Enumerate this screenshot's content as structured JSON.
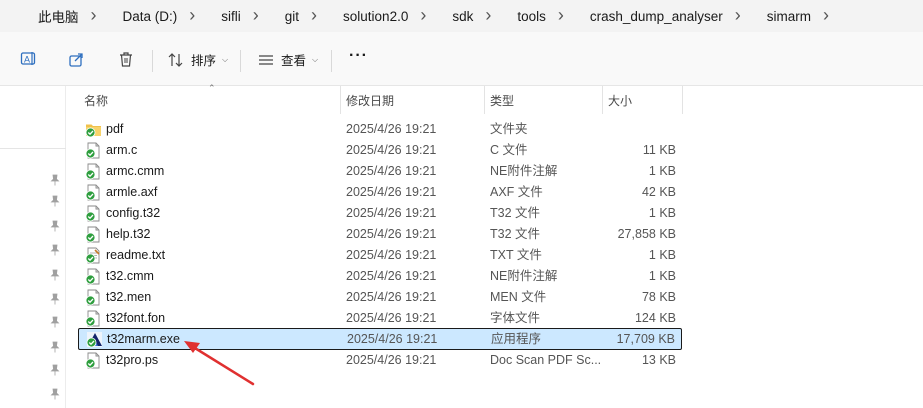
{
  "breadcrumb": [
    "此电脑",
    "Data (D:)",
    "sifli",
    "git",
    "solution2.0",
    "sdk",
    "tools",
    "crash_dump_analyser",
    "simarm"
  ],
  "toolbar": {
    "sort_label": "排序",
    "view_label": "查看",
    "more_label": "···"
  },
  "columns": {
    "name": "名称",
    "date": "修改日期",
    "type": "类型",
    "size": "大小"
  },
  "files": [
    {
      "name": "pdf",
      "date": "2025/4/26 19:21",
      "type": "文件夹",
      "size": "",
      "icon": "folder-icon"
    },
    {
      "name": "arm.c",
      "date": "2025/4/26 19:21",
      "type": "C 文件",
      "size": "11 KB",
      "icon": "file-icon"
    },
    {
      "name": "armc.cmm",
      "date": "2025/4/26 19:21",
      "type": "NE附件注解",
      "size": "1 KB",
      "icon": "file-icon"
    },
    {
      "name": "armle.axf",
      "date": "2025/4/26 19:21",
      "type": "AXF 文件",
      "size": "42 KB",
      "icon": "file-icon"
    },
    {
      "name": "config.t32",
      "date": "2025/4/26 19:21",
      "type": "T32 文件",
      "size": "1 KB",
      "icon": "file-icon"
    },
    {
      "name": "help.t32",
      "date": "2025/4/26 19:21",
      "type": "T32 文件",
      "size": "27,858 KB",
      "icon": "file-icon"
    },
    {
      "name": "readme.txt",
      "date": "2025/4/26 19:21",
      "type": "TXT 文件",
      "size": "1 KB",
      "icon": "text-file-icon"
    },
    {
      "name": "t32.cmm",
      "date": "2025/4/26 19:21",
      "type": "NE附件注解",
      "size": "1 KB",
      "icon": "file-icon"
    },
    {
      "name": "t32.men",
      "date": "2025/4/26 19:21",
      "type": "MEN 文件",
      "size": "78 KB",
      "icon": "file-icon"
    },
    {
      "name": "t32font.fon",
      "date": "2025/4/26 19:21",
      "type": "字体文件",
      "size": "124 KB",
      "icon": "file-icon"
    },
    {
      "name": "t32marm.exe",
      "date": "2025/4/26 19:21",
      "type": "应用程序",
      "size": "17,709 KB",
      "icon": "app-icon",
      "selected": true
    },
    {
      "name": "t32pro.ps",
      "date": "2025/4/26 19:21",
      "type": "Doc Scan PDF Sc...",
      "size": "13 KB",
      "icon": "file-icon"
    }
  ],
  "colors": {
    "selection_bg": "#cce8ff",
    "annotation_arrow": "#e03030",
    "sync_check": "#2e9e3e"
  }
}
